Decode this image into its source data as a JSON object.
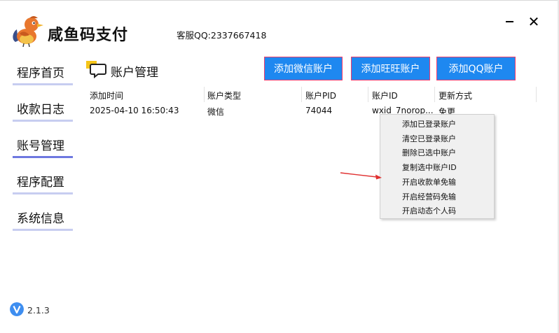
{
  "app": {
    "title": "咸鱼码支付",
    "support": "客服QQ:2337667418",
    "close_glyph": "✕",
    "version": "2.1.3",
    "version_icon": "v-badge-icon",
    "logo_icon": "bird-logo-icon"
  },
  "sidebar": {
    "items": [
      {
        "label": "程序首页"
      },
      {
        "label": "收款日志"
      },
      {
        "label": "账号管理",
        "active": true
      },
      {
        "label": "程序配置"
      },
      {
        "label": "系统信息"
      }
    ]
  },
  "section": {
    "title": "账户管理",
    "icon": "chat-bubble-icon"
  },
  "actions": {
    "add_wechat": "添加微信账户",
    "add_wangwang": "添加旺旺账户",
    "add_qq": "添加QQ账户"
  },
  "table": {
    "columns": [
      "添加时间",
      "账户类型",
      "账户PID",
      "账户ID",
      "更新方式"
    ],
    "rows": [
      [
        "2025-04-10 16:50:43",
        "微信",
        "74044",
        "wxid_7norop...",
        "免更"
      ]
    ]
  },
  "context_menu": {
    "items": [
      "添加已登录账户",
      "清空已登录账户",
      "删除已选中账户",
      "复制选中账户ID",
      "开启收款单免输",
      "开启经营码免输",
      "开启动态个人码"
    ]
  },
  "colors": {
    "button_bg": "#1e88f0",
    "button_border": "#f43b6c",
    "nav_underline": "#c7cdf0",
    "nav_underline_active": "#6e78e0",
    "arrow": "#e03030"
  }
}
